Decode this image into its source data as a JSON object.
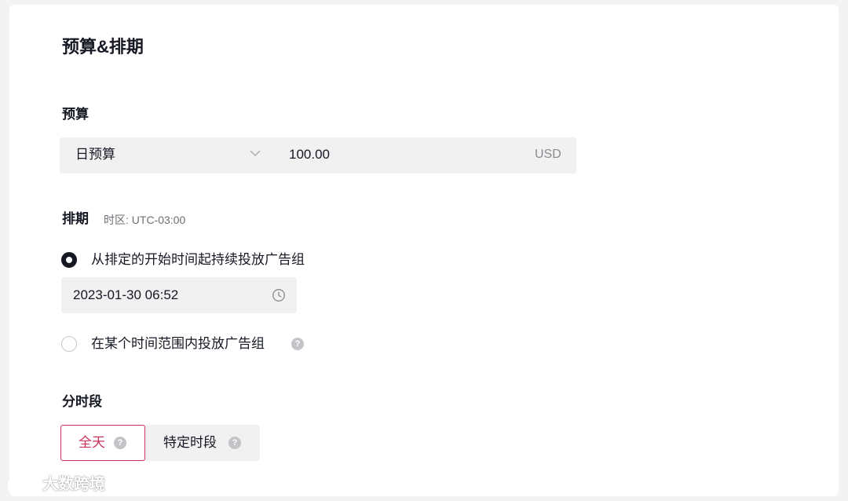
{
  "page_title": "预算&排期",
  "budget": {
    "section_label": "预算",
    "type_selected": "日预算",
    "amount": "100.00",
    "currency": "USD"
  },
  "schedule": {
    "section_label": "排期",
    "timezone": "时区: UTC-03:00",
    "option_continuous": {
      "label": "从排定的开始时间起持续投放广告组",
      "selected": true
    },
    "start_datetime": "2023-01-30 06:52",
    "option_range": {
      "label": "在某个时间范围内投放广告组",
      "selected": false
    }
  },
  "dayparting": {
    "section_label": "分时段",
    "options": [
      {
        "label": "全天",
        "selected": true
      },
      {
        "label": "特定时段",
        "selected": false
      }
    ]
  },
  "help_glyph": "?",
  "watermark": "大数跨境",
  "colors": {
    "accent": "#c9335a",
    "text": "#161823",
    "input_bg": "#f1f1f2"
  }
}
